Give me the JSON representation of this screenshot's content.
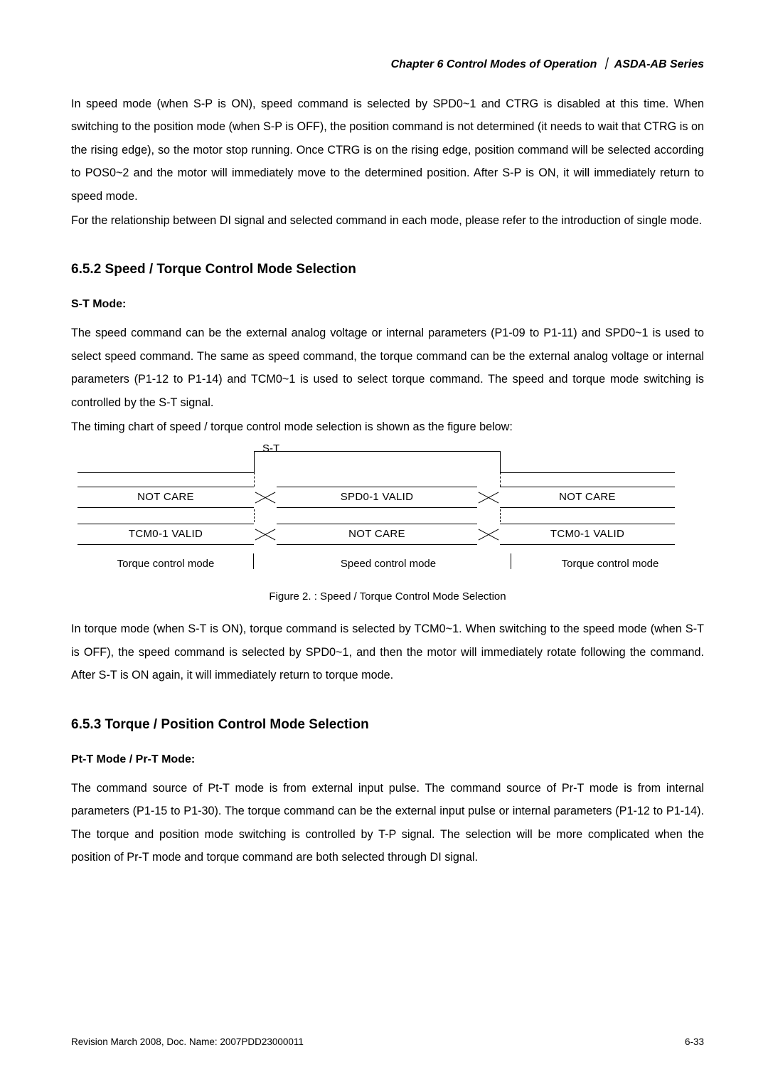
{
  "header": {
    "chapter": "Chapter 6  Control Modes of Operation",
    "separator": "｜",
    "series": "ASDA-AB Series"
  },
  "p1": "In speed mode (when S-P is ON), speed command is selected by SPD0~1 and CTRG is disabled at this time. When switching to the position mode (when S-P is OFF), the position command is not determined (it needs to wait that CTRG is on the rising edge), so the motor stop running. Once CTRG is on the rising edge, position command will be selected according to POS0~2 and the motor will immediately move to the determined position. After S-P is ON, it will immediately return to speed mode.",
  "p2": "For the relationship between DI signal and selected command in each mode, please refer to the introduction of single mode.",
  "section652": {
    "title": "6.5.2  Speed / Torque Control Mode Selection",
    "sub": "S-T Mode:",
    "p1": "The speed command can be the external analog voltage or internal parameters (P1-09 to P1-11) and SPD0~1 is used to select speed command. The same as speed command, the torque command can be the external analog voltage or internal parameters (P1-12 to P1-14) and TCM0~1 is used to select torque command. The speed and torque mode switching is controlled by the S-T signal.",
    "p2": "The timing chart of speed / torque control mode selection is shown as the figure below:"
  },
  "timing": {
    "st": "S-T",
    "r1": {
      "l": "NOT CARE",
      "m": "SPD0-1 VALID",
      "r": "NOT CARE"
    },
    "r2": {
      "l": "TCM0-1 VALID",
      "m": "NOT CARE",
      "r": "TCM0-1 VALID"
    },
    "r3": {
      "l": "Torque control mode",
      "m": "Speed control mode",
      "r": "Torque control mode"
    }
  },
  "figcap": "Figure 2. : Speed / Torque Control Mode Selection",
  "p3": "In torque mode (when S-T is ON), torque command is selected by TCM0~1. When switching to the speed mode (when S-T is OFF), the speed command is selected by SPD0~1, and then the motor will immediately rotate following the command. After S-T is ON again, it will immediately return to torque mode.",
  "section653": {
    "title": "6.5.3  Torque / Position Control Mode Selection",
    "sub": "Pt-T Mode / Pr-T Mode:",
    "p1": "The command source of Pt-T mode is from external input pulse. The command source of Pr-T mode is from internal parameters (P1-15 to P1-30). The torque command can be the external input pulse or internal parameters (P1-12 to P1-14). The torque and position mode switching is controlled by T-P signal. The selection will be more complicated when the position of Pr-T mode and torque command are both selected through DI signal."
  },
  "footer": {
    "left": "Revision March 2008, Doc. Name: 2007PDD23000011",
    "right": "6-33"
  }
}
